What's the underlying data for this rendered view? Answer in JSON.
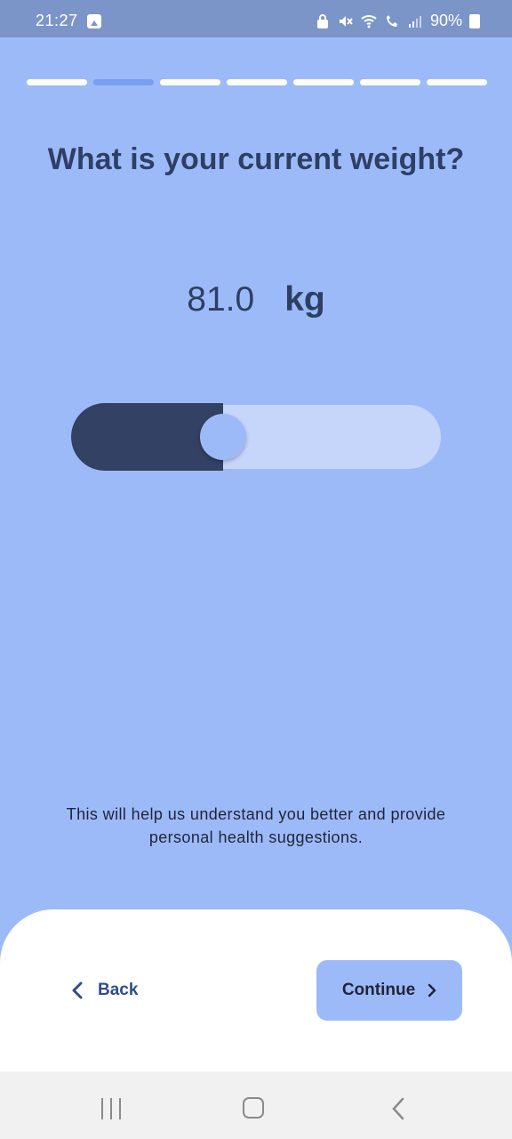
{
  "status_bar": {
    "time": "21:27",
    "battery": "90%",
    "icons": [
      "image-icon",
      "lock-icon",
      "mute-icon",
      "wifi-icon",
      "wifi-call-icon",
      "signal-icon",
      "battery-charging-icon"
    ]
  },
  "progress": {
    "total_steps": 7,
    "current_step": 2
  },
  "question": {
    "title": "What is your current weight?"
  },
  "weight": {
    "value": "81.0",
    "unit": "kg",
    "slider_fraction": 0.41
  },
  "helper_text": "This will help us understand you better and provide personal health suggestions.",
  "buttons": {
    "back_label": "Back",
    "continue_label": "Continue"
  },
  "colors": {
    "background": "#9dbaf8",
    "status_bar": "#7c95c8",
    "primary_dark": "#324164",
    "title_text": "#2e3f66",
    "back_text": "#2f4d8d",
    "track_light": "#c6d6fb",
    "progress_active": "#7a9ef0"
  }
}
